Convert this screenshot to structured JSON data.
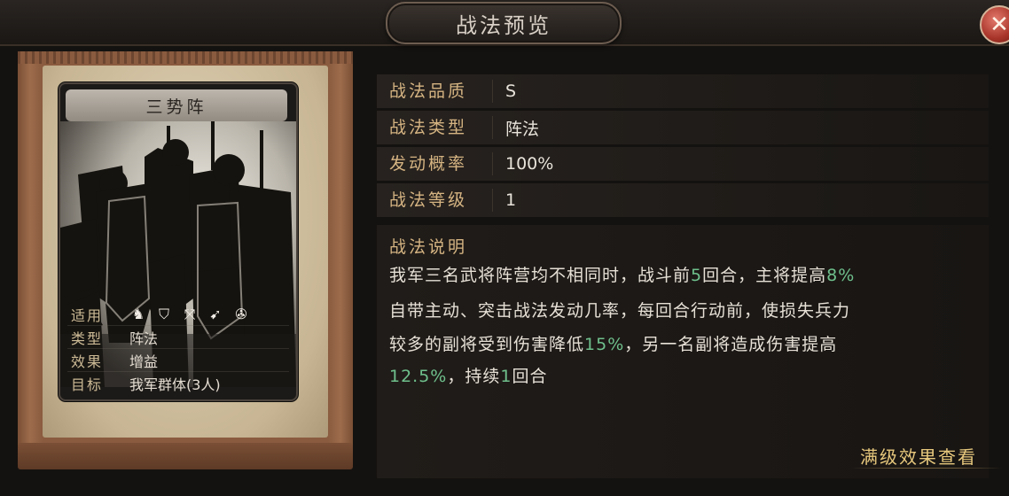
{
  "window": {
    "title": "战法预览",
    "close_icon": "close-icon"
  },
  "card": {
    "name": "三势阵",
    "rows": {
      "applicable_label": "适用",
      "type_label": "类型",
      "type_value": "阵法",
      "effect_label": "效果",
      "effect_value": "增益",
      "target_label": "目标",
      "target_value": "我军群体(3人)"
    },
    "unit_icons": [
      "cavalry-icon",
      "shield-icon",
      "bow-icon",
      "spear-icon",
      "chariot-icon"
    ]
  },
  "attributes": [
    {
      "label": "战法品质",
      "value": "S"
    },
    {
      "label": "战法类型",
      "value": "阵法"
    },
    {
      "label": "发动概率",
      "value": "100%"
    },
    {
      "label": "战法等级",
      "value": "1"
    }
  ],
  "description": {
    "heading": "战法说明",
    "line1": {
      "a": "我军三名武将阵营均不相同时，战斗前",
      "n1": "5",
      "b": "回合，主将提高",
      "n2": "8%"
    },
    "line2": "自带主动、突击战法发动几率，每回合行动前，使损失兵力",
    "line3": {
      "a": "较多的副将受到伤害降低",
      "n1": "15%",
      "b": "，另一名副将造成伤害提高"
    },
    "line4": {
      "n1": "12.5%",
      "a": "，持续",
      "n2": "1",
      "b": "回合"
    }
  },
  "view_full_label": "满级效果查看",
  "colors": {
    "accent_gold": "#d5b482",
    "highlight_green": "#6fc08c",
    "close_red": "#a83429"
  }
}
